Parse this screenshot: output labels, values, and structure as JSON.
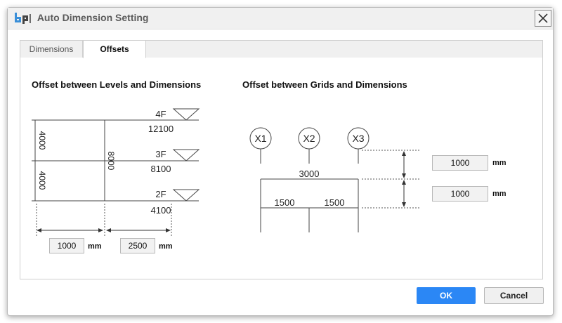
{
  "window": {
    "title": "Auto Dimension Setting",
    "separator": "|",
    "logo_icon": "bp-logo-icon",
    "close_icon": "close-icon"
  },
  "tabs": [
    {
      "label": "Dimensions",
      "active": false
    },
    {
      "label": "Offsets",
      "active": true
    }
  ],
  "levels_section": {
    "title": "Offset between Levels and Dimensions",
    "levels": [
      "4F",
      "3F",
      "2F"
    ],
    "elevations": [
      "12100",
      "8100",
      "4100"
    ],
    "story_heights": [
      "4000",
      "4000"
    ],
    "total_height": "8000",
    "offset_1": {
      "value": "1000",
      "unit": "mm"
    },
    "offset_2": {
      "value": "2500",
      "unit": "mm"
    }
  },
  "grids_section": {
    "title": "Offset between Grids and Dimensions",
    "grids": [
      "X1",
      "X2",
      "X3"
    ],
    "overall_dim": "3000",
    "span_dims": [
      "1500",
      "1500"
    ],
    "offset_1": {
      "value": "1000",
      "unit": "mm"
    },
    "offset_2": {
      "value": "1000",
      "unit": "mm"
    }
  },
  "footer": {
    "ok_label": "OK",
    "cancel_label": "Cancel",
    "accent_color": "#2b87f5"
  }
}
